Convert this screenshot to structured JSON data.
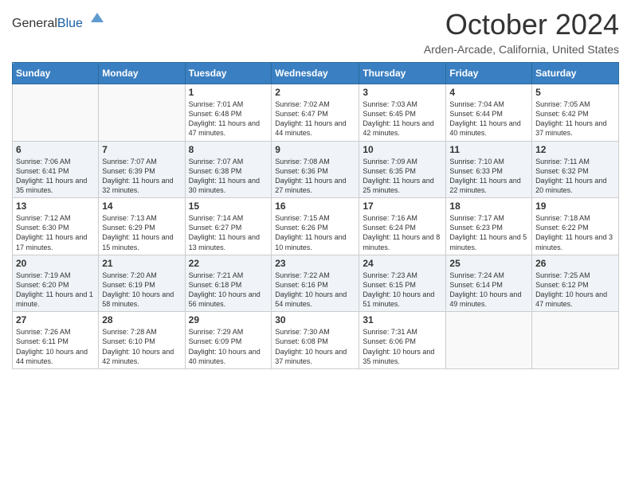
{
  "logo": {
    "general": "General",
    "blue": "Blue"
  },
  "title": "October 2024",
  "location": "Arden-Arcade, California, United States",
  "days_of_week": [
    "Sunday",
    "Monday",
    "Tuesday",
    "Wednesday",
    "Thursday",
    "Friday",
    "Saturday"
  ],
  "weeks": [
    [
      {
        "day": "",
        "info": ""
      },
      {
        "day": "",
        "info": ""
      },
      {
        "day": "1",
        "info": "Sunrise: 7:01 AM\nSunset: 6:48 PM\nDaylight: 11 hours and 47 minutes."
      },
      {
        "day": "2",
        "info": "Sunrise: 7:02 AM\nSunset: 6:47 PM\nDaylight: 11 hours and 44 minutes."
      },
      {
        "day": "3",
        "info": "Sunrise: 7:03 AM\nSunset: 6:45 PM\nDaylight: 11 hours and 42 minutes."
      },
      {
        "day": "4",
        "info": "Sunrise: 7:04 AM\nSunset: 6:44 PM\nDaylight: 11 hours and 40 minutes."
      },
      {
        "day": "5",
        "info": "Sunrise: 7:05 AM\nSunset: 6:42 PM\nDaylight: 11 hours and 37 minutes."
      }
    ],
    [
      {
        "day": "6",
        "info": "Sunrise: 7:06 AM\nSunset: 6:41 PM\nDaylight: 11 hours and 35 minutes."
      },
      {
        "day": "7",
        "info": "Sunrise: 7:07 AM\nSunset: 6:39 PM\nDaylight: 11 hours and 32 minutes."
      },
      {
        "day": "8",
        "info": "Sunrise: 7:07 AM\nSunset: 6:38 PM\nDaylight: 11 hours and 30 minutes."
      },
      {
        "day": "9",
        "info": "Sunrise: 7:08 AM\nSunset: 6:36 PM\nDaylight: 11 hours and 27 minutes."
      },
      {
        "day": "10",
        "info": "Sunrise: 7:09 AM\nSunset: 6:35 PM\nDaylight: 11 hours and 25 minutes."
      },
      {
        "day": "11",
        "info": "Sunrise: 7:10 AM\nSunset: 6:33 PM\nDaylight: 11 hours and 22 minutes."
      },
      {
        "day": "12",
        "info": "Sunrise: 7:11 AM\nSunset: 6:32 PM\nDaylight: 11 hours and 20 minutes."
      }
    ],
    [
      {
        "day": "13",
        "info": "Sunrise: 7:12 AM\nSunset: 6:30 PM\nDaylight: 11 hours and 17 minutes."
      },
      {
        "day": "14",
        "info": "Sunrise: 7:13 AM\nSunset: 6:29 PM\nDaylight: 11 hours and 15 minutes."
      },
      {
        "day": "15",
        "info": "Sunrise: 7:14 AM\nSunset: 6:27 PM\nDaylight: 11 hours and 13 minutes."
      },
      {
        "day": "16",
        "info": "Sunrise: 7:15 AM\nSunset: 6:26 PM\nDaylight: 11 hours and 10 minutes."
      },
      {
        "day": "17",
        "info": "Sunrise: 7:16 AM\nSunset: 6:24 PM\nDaylight: 11 hours and 8 minutes."
      },
      {
        "day": "18",
        "info": "Sunrise: 7:17 AM\nSunset: 6:23 PM\nDaylight: 11 hours and 5 minutes."
      },
      {
        "day": "19",
        "info": "Sunrise: 7:18 AM\nSunset: 6:22 PM\nDaylight: 11 hours and 3 minutes."
      }
    ],
    [
      {
        "day": "20",
        "info": "Sunrise: 7:19 AM\nSunset: 6:20 PM\nDaylight: 11 hours and 1 minute."
      },
      {
        "day": "21",
        "info": "Sunrise: 7:20 AM\nSunset: 6:19 PM\nDaylight: 10 hours and 58 minutes."
      },
      {
        "day": "22",
        "info": "Sunrise: 7:21 AM\nSunset: 6:18 PM\nDaylight: 10 hours and 56 minutes."
      },
      {
        "day": "23",
        "info": "Sunrise: 7:22 AM\nSunset: 6:16 PM\nDaylight: 10 hours and 54 minutes."
      },
      {
        "day": "24",
        "info": "Sunrise: 7:23 AM\nSunset: 6:15 PM\nDaylight: 10 hours and 51 minutes."
      },
      {
        "day": "25",
        "info": "Sunrise: 7:24 AM\nSunset: 6:14 PM\nDaylight: 10 hours and 49 minutes."
      },
      {
        "day": "26",
        "info": "Sunrise: 7:25 AM\nSunset: 6:12 PM\nDaylight: 10 hours and 47 minutes."
      }
    ],
    [
      {
        "day": "27",
        "info": "Sunrise: 7:26 AM\nSunset: 6:11 PM\nDaylight: 10 hours and 44 minutes."
      },
      {
        "day": "28",
        "info": "Sunrise: 7:28 AM\nSunset: 6:10 PM\nDaylight: 10 hours and 42 minutes."
      },
      {
        "day": "29",
        "info": "Sunrise: 7:29 AM\nSunset: 6:09 PM\nDaylight: 10 hours and 40 minutes."
      },
      {
        "day": "30",
        "info": "Sunrise: 7:30 AM\nSunset: 6:08 PM\nDaylight: 10 hours and 37 minutes."
      },
      {
        "day": "31",
        "info": "Sunrise: 7:31 AM\nSunset: 6:06 PM\nDaylight: 10 hours and 35 minutes."
      },
      {
        "day": "",
        "info": ""
      },
      {
        "day": "",
        "info": ""
      }
    ]
  ]
}
